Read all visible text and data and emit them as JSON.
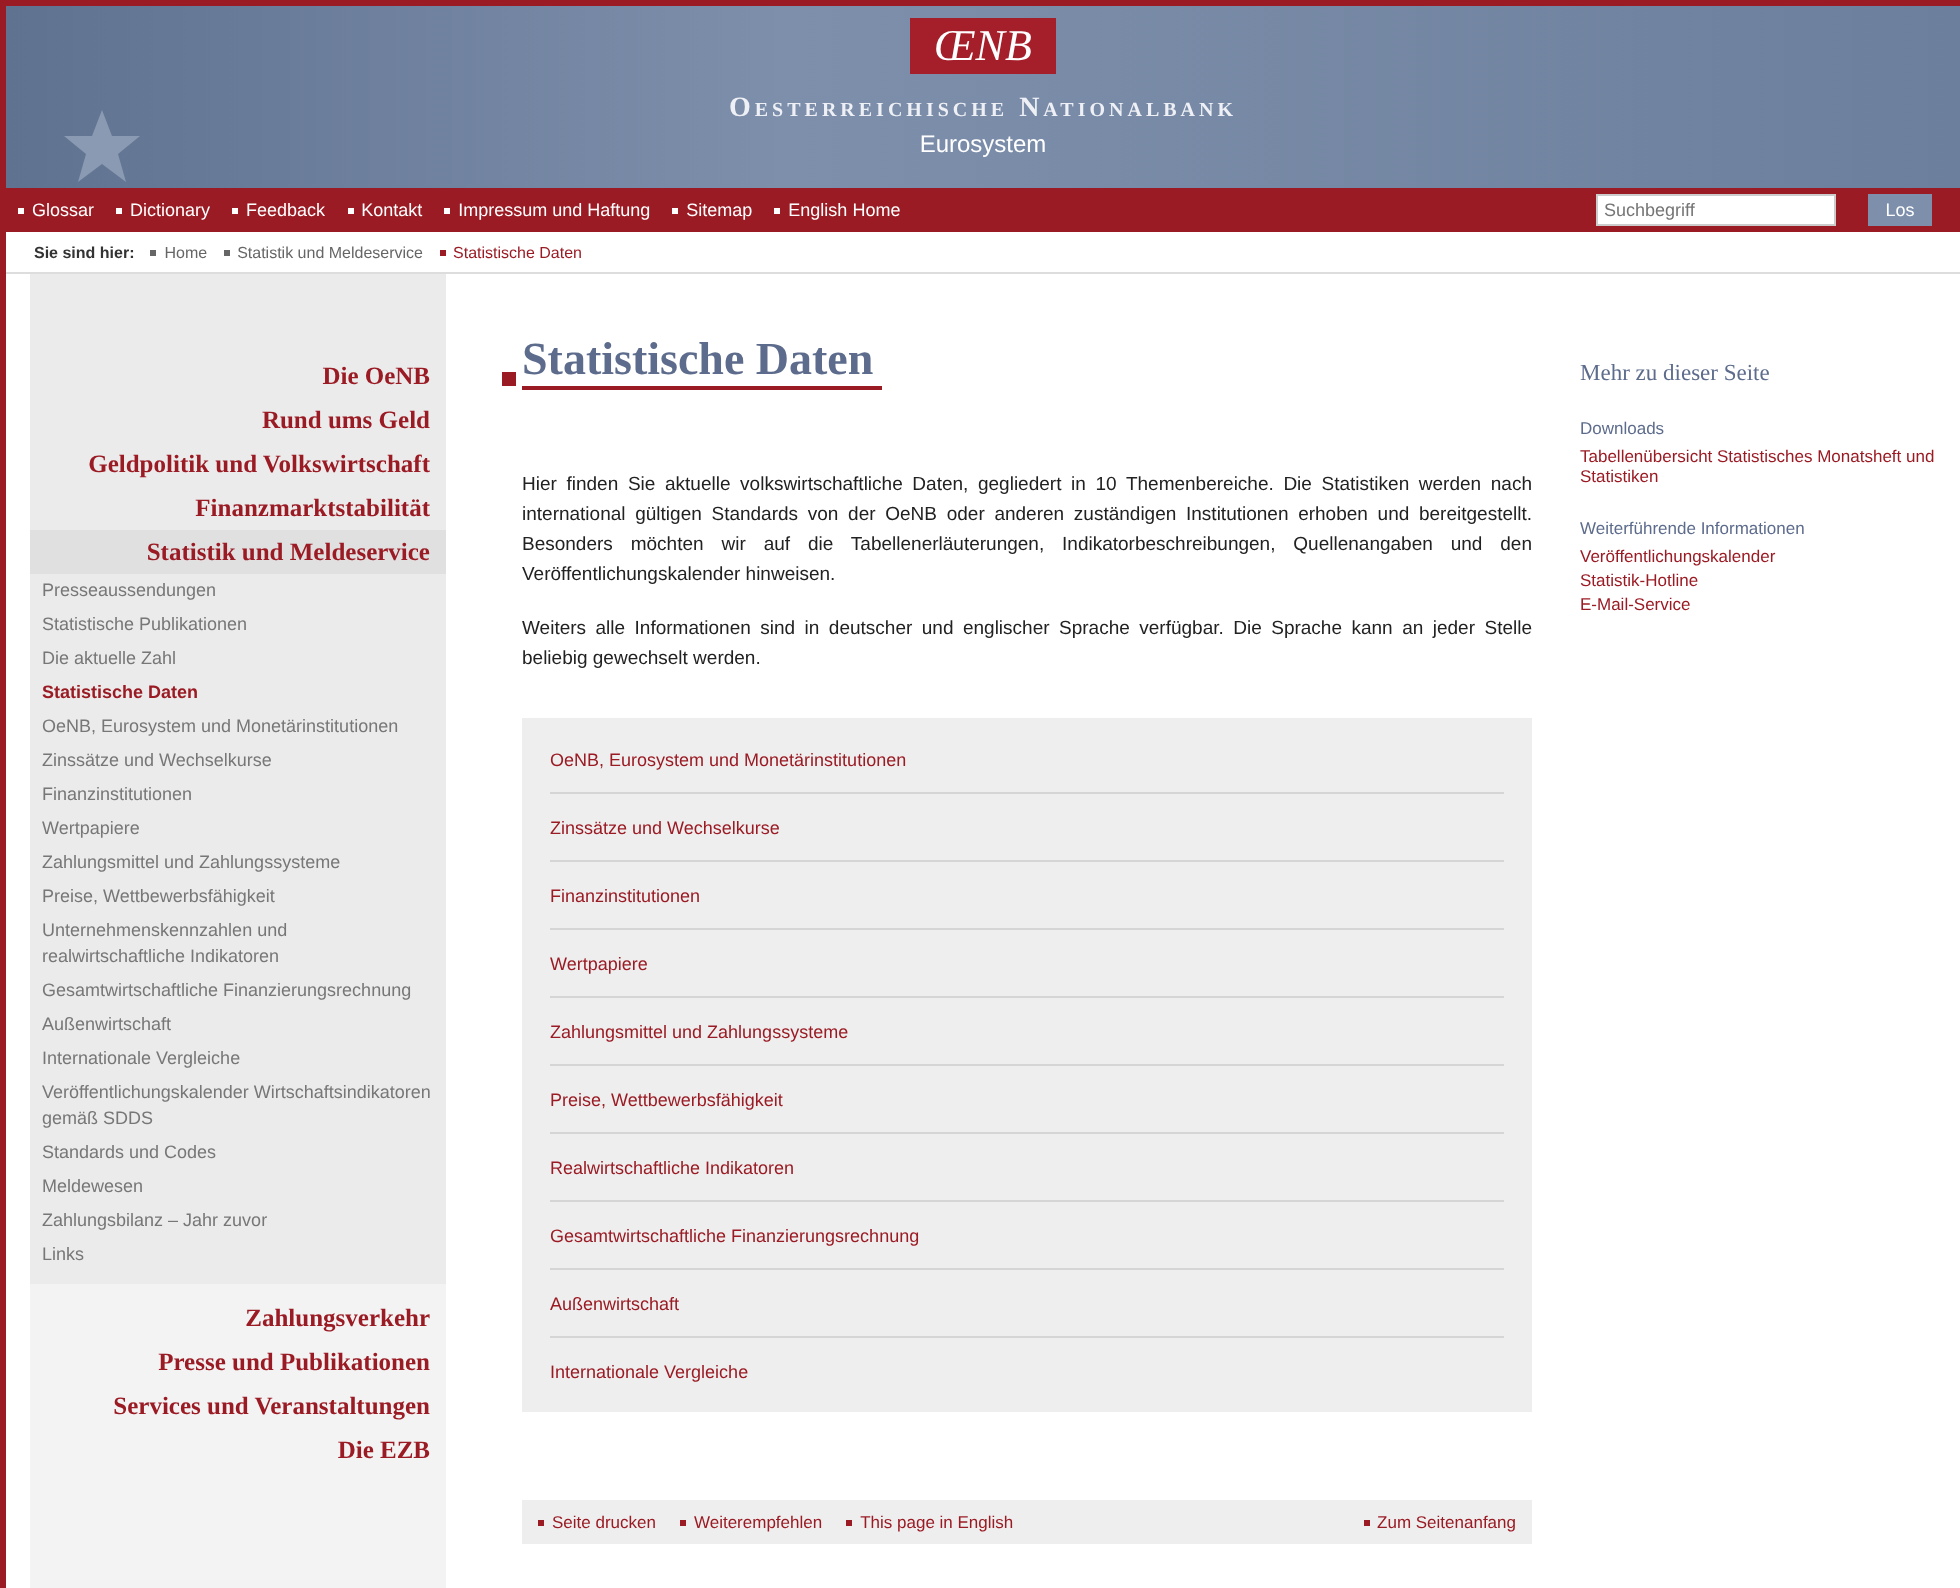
{
  "header": {
    "logo": "ŒNB",
    "title": "Oesterreichische Nationalbank",
    "subtitle": "Eurosystem"
  },
  "top_nav": [
    "Glossar",
    "Dictionary",
    "Feedback",
    "Kontakt",
    "Impressum und Haftung",
    "Sitemap",
    "English Home"
  ],
  "search": {
    "placeholder": "Suchbegriff",
    "button": "Los"
  },
  "breadcrumb": {
    "label": "Sie sind hier:",
    "items": [
      "Home",
      "Statistik und Meldeservice",
      "Statistische Daten"
    ]
  },
  "sidebar": {
    "sections_top": [
      "Die OeNB",
      "Rund ums Geld",
      "Geldpolitik und Volkswirtschaft",
      "Finanzmarktstabilität"
    ],
    "current_section": "Statistik und Meldeservice",
    "items": [
      {
        "label": "Presseaussendungen",
        "selected": false
      },
      {
        "label": "Statistische Publikationen",
        "selected": false
      },
      {
        "label": "Die aktuelle Zahl",
        "selected": false
      },
      {
        "label": "Statistische Daten",
        "selected": true
      },
      {
        "label": "OeNB, Eurosystem und Monetärinstitutionen",
        "selected": false
      },
      {
        "label": "Zinssätze und Wechselkurse",
        "selected": false
      },
      {
        "label": "Finanzinstitutionen",
        "selected": false
      },
      {
        "label": "Wertpapiere",
        "selected": false
      },
      {
        "label": "Zahlungsmittel und Zahlungssysteme",
        "selected": false
      },
      {
        "label": "Preise, Wettbewerbsfähigkeit",
        "selected": false
      },
      {
        "label": "Unternehmenskennzahlen und realwirtschaftliche Indikatoren",
        "selected": false
      },
      {
        "label": "Gesamtwirtschaftliche Finanzierungsrechnung",
        "selected": false
      },
      {
        "label": "Außenwirtschaft",
        "selected": false
      },
      {
        "label": "Internationale Vergleiche",
        "selected": false
      },
      {
        "label": "Veröffentlichungskalender Wirtschaftsindikatoren gemäß SDDS",
        "selected": false
      },
      {
        "label": "Standards und Codes",
        "selected": false
      },
      {
        "label": "Meldewesen",
        "selected": false
      },
      {
        "label": "Zahlungsbilanz – Jahr zuvor",
        "selected": false
      },
      {
        "label": "Links",
        "selected": false
      }
    ],
    "sections_bottom": [
      "Zahlungsverkehr",
      "Presse und Publikationen",
      "Services und Veranstaltungen",
      "Die EZB"
    ]
  },
  "main": {
    "title": "Statistische Daten",
    "paragraphs": [
      "Hier finden Sie aktuelle volkswirtschaftliche Daten, gegliedert in 10 Themenbereiche. Die Statistiken werden nach international gültigen Standards von der OeNB oder anderen zuständigen Institutionen erhoben und bereitgestellt. Besonders möchten wir auf die Tabellenerläuterungen, Indikatorbeschreibungen, Quellenangaben und den Veröffentlichungskalender hinweisen.",
      "Weiters alle Informationen sind in deutscher und englischer Sprache verfügbar. Die Sprache kann an jeder Stelle beliebig gewechselt werden."
    ],
    "topics": [
      "OeNB, Eurosystem und Monetärinstitutionen",
      "Zinssätze und Wechselkurse",
      "Finanzinstitutionen",
      "Wertpapiere",
      "Zahlungsmittel und Zahlungssysteme",
      "Preise, Wettbewerbsfähigkeit",
      "Realwirtschaftliche Indikatoren",
      "Gesamtwirtschaftliche Finanzierungsrechnung",
      "Außenwirtschaft",
      "Internationale Vergleiche"
    ],
    "footer_links": [
      "Seite drucken",
      "Weiterempfehlen",
      "This page in English"
    ],
    "top_link": "Zum Seitenanfang"
  },
  "aside": {
    "title": "Mehr zu dieser Seite",
    "groups": [
      {
        "label": "Downloads",
        "links": [
          "Tabellenübersicht Statistisches Monatsheft und Statistiken"
        ]
      },
      {
        "label": "Weiterführende Informationen",
        "links": [
          "Veröffentlichungskalender",
          "Statistik-Hotline",
          "E-Mail-Service"
        ]
      }
    ]
  }
}
